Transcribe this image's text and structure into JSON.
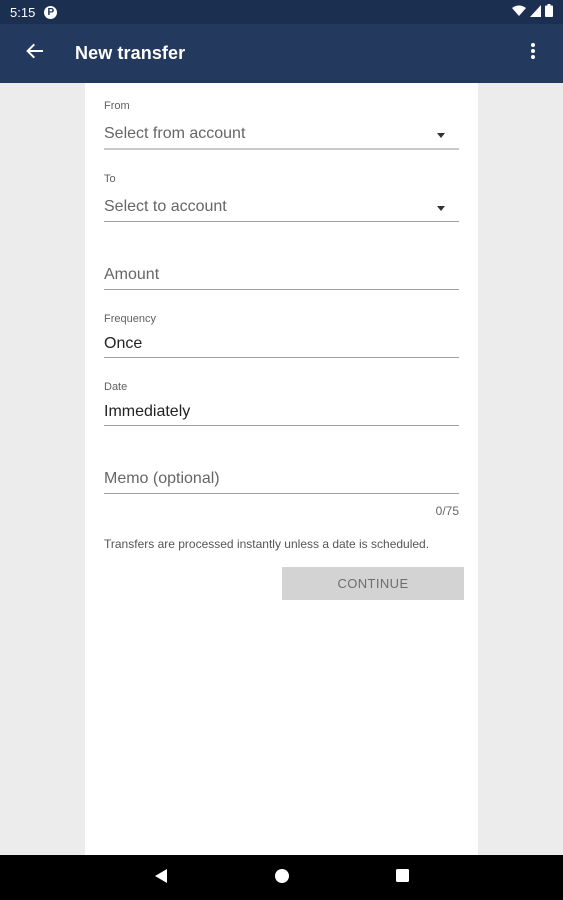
{
  "status_bar": {
    "time": "5:15",
    "badge": "P"
  },
  "app_bar": {
    "title": "New transfer"
  },
  "form": {
    "from": {
      "label": "From",
      "value": "Select from account"
    },
    "to": {
      "label": "To",
      "value": "Select to account"
    },
    "amount": {
      "placeholder": "Amount"
    },
    "frequency": {
      "label": "Frequency",
      "value": "Once"
    },
    "date": {
      "label": "Date",
      "value": "Immediately"
    },
    "memo": {
      "placeholder": "Memo (optional)",
      "counter": "0/75"
    },
    "helper_text": "Transfers are processed instantly unless a date is scheduled.",
    "continue_label": "CONTINUE"
  },
  "colors": {
    "status_bar": "#1b2f50",
    "app_bar": "#23395d",
    "background": "#ececec",
    "button_disabled": "#d3d3d3"
  }
}
